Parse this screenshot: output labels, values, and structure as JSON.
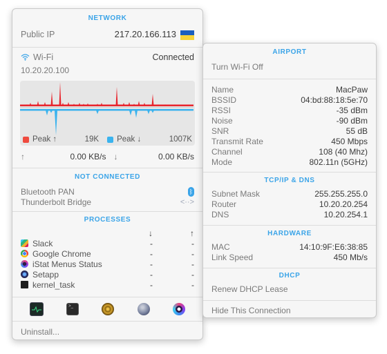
{
  "network": {
    "section_title": "NETWORK",
    "public_ip_label": "Public IP",
    "public_ip_value": "217.20.166.113",
    "flag": "ukraine-flag-icon",
    "wifi": {
      "label": "Wi-Fi",
      "status": "Connected",
      "ip": "10.20.20.100",
      "icon": "wifi-icon"
    },
    "graph": {
      "upload_color": "#e8262e",
      "download_color": "#3ab3ee",
      "upload_spikes": [
        0.05,
        0.12,
        0.2,
        0.15,
        0.6,
        1.0,
        0.12,
        0.15,
        0.08,
        0.12,
        0.08,
        0.1,
        0.08,
        0.12,
        0.8,
        0.12,
        0.15,
        0.08,
        0.2,
        0.12,
        0.05,
        0.5,
        0.05,
        0.05,
        0.05
      ],
      "download_spikes": [
        0.2,
        0.1,
        1.0,
        0.15,
        0.2,
        0.3,
        0.15,
        0.1
      ],
      "legend": {
        "peak_up_label": "Peak ↑",
        "peak_up_value": "19K",
        "peak_down_label": "Peak ↓",
        "peak_down_value": "1007K"
      }
    },
    "rates": {
      "up_arrow": "↑",
      "up_value": "0.00 KB/s",
      "down_arrow": "↓",
      "down_value": "0.00 KB/s"
    }
  },
  "not_connected": {
    "section_title": "NOT CONNECTED",
    "items": [
      {
        "label": "Bluetooth PAN",
        "icon": "bluetooth-icon"
      },
      {
        "label": "Thunderbolt Bridge",
        "icon": "thunderbolt-bridge-icon"
      }
    ]
  },
  "processes": {
    "section_title": "PROCESSES",
    "col_down": "↓",
    "col_up": "↑",
    "rows": [
      {
        "name": "Slack",
        "down": "-",
        "up": "-",
        "icon": "slack-icon"
      },
      {
        "name": "Google Chrome",
        "down": "-",
        "up": "-",
        "icon": "chrome-icon"
      },
      {
        "name": "iStat Menus Status",
        "down": "-",
        "up": "-",
        "icon": "istat-icon"
      },
      {
        "name": "Setapp",
        "down": "-",
        "up": "-",
        "icon": "setapp-icon"
      },
      {
        "name": "kernel_task",
        "down": "-",
        "up": "-",
        "icon": "terminal-icon"
      }
    ]
  },
  "dock_icons": [
    "activity-monitor-icon",
    "terminal-icon",
    "network-radar-icon",
    "network-utility-icon",
    "istat-menus-icon"
  ],
  "footer": {
    "uninstall_label": "Uninstall..."
  },
  "airport": {
    "section_title": "AIRPORT",
    "toggle_label": "Turn Wi-Fi Off",
    "details": [
      {
        "k": "Name",
        "v": "MacPaw"
      },
      {
        "k": "BSSID",
        "v": "04:bd:88:18:5e:70"
      },
      {
        "k": "RSSI",
        "v": "-35 dBm"
      },
      {
        "k": "Noise",
        "v": "-90 dBm"
      },
      {
        "k": "SNR",
        "v": "55 dB"
      },
      {
        "k": "Transmit Rate",
        "v": "450 Mbps"
      },
      {
        "k": "Channel",
        "v": "108 (40 Mhz)"
      },
      {
        "k": "Mode",
        "v": "802.11n (5GHz)"
      }
    ]
  },
  "tcpip": {
    "section_title": "TCP/IP & DNS",
    "details": [
      {
        "k": "Subnet Mask",
        "v": "255.255.255.0"
      },
      {
        "k": "Router",
        "v": "10.20.20.254"
      },
      {
        "k": "DNS",
        "v": "10.20.254.1"
      }
    ]
  },
  "hardware": {
    "section_title": "HARDWARE",
    "details": [
      {
        "k": "MAC",
        "v": "14:10:9F:E6:38:85"
      },
      {
        "k": "Link Speed",
        "v": "450 Mb/s"
      }
    ]
  },
  "dhcp": {
    "section_title": "DHCP",
    "renew_label": "Renew DHCP Lease"
  },
  "hide_label": "Hide This Connection"
}
